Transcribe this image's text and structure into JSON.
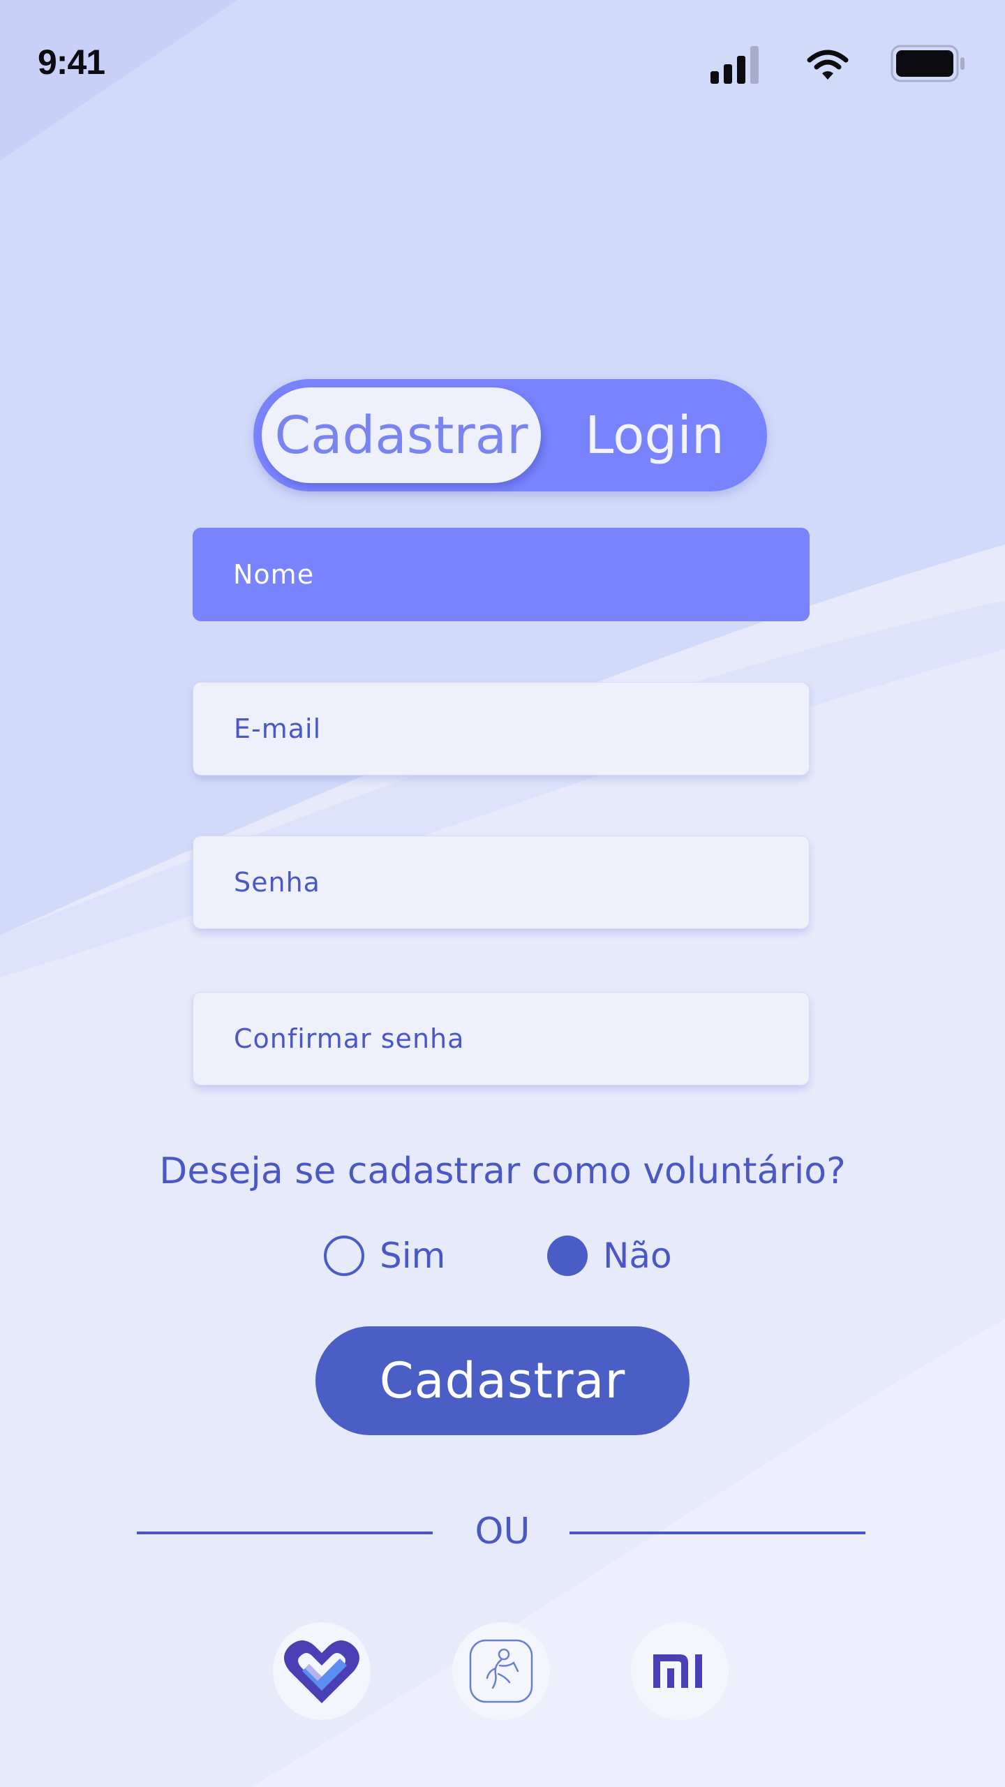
{
  "status_bar": {
    "time": "9:41"
  },
  "auth_toggle": {
    "signup_label": "Cadastrar",
    "login_label": "Login",
    "selected": "signup"
  },
  "form": {
    "name_placeholder": "Nome",
    "email_placeholder": "E-mail",
    "password_placeholder": "Senha",
    "confirm_password_placeholder": "Confirmar senha"
  },
  "volunteer": {
    "question": "Deseja se cadastrar como voluntário?",
    "options": [
      {
        "label": "Sim",
        "selected": false
      },
      {
        "label": "Não",
        "selected": true
      }
    ]
  },
  "submit_label": "Cadastrar",
  "divider_label": "OU",
  "social_providers": [
    "google-fit-icon",
    "health-app-icon",
    "xiaomi-icon"
  ],
  "colors": {
    "primary": "#7883fd",
    "accent": "#4a5ec6",
    "field_bg": "#eef0fc",
    "text": "#4a57c4"
  }
}
